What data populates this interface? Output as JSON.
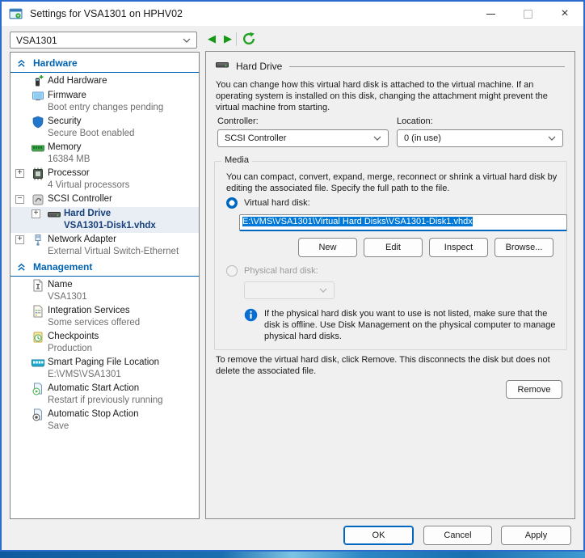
{
  "window": {
    "title": "Settings for VSA1301 on HPHV02"
  },
  "icons": {
    "back": "◀",
    "forward": "▶",
    "close": "×"
  },
  "toolbar": {
    "vm_name": "VSA1301"
  },
  "sidebar": {
    "sections": [
      {
        "header": "Hardware",
        "items": [
          {
            "label": "Add Hardware"
          },
          {
            "label": "Firmware",
            "sub": "Boot entry changes pending"
          },
          {
            "label": "Security",
            "sub": "Secure Boot enabled"
          },
          {
            "label": "Memory",
            "sub": "16384 MB"
          },
          {
            "label": "Processor",
            "sub": "4 Virtual processors",
            "expander": "+"
          },
          {
            "label": "SCSI Controller",
            "expander": "−"
          },
          {
            "label": "Hard Drive",
            "sub": "VSA1301-Disk1.vhdx",
            "expander": "+"
          },
          {
            "label": "Network Adapter",
            "sub": "External Virtual Switch-Ethernet",
            "expander": "+"
          }
        ]
      },
      {
        "header": "Management",
        "items": [
          {
            "label": "Name",
            "sub": "VSA1301"
          },
          {
            "label": "Integration Services",
            "sub": "Some services offered"
          },
          {
            "label": "Checkpoints",
            "sub": "Production"
          },
          {
            "label": "Smart Paging File Location",
            "sub": "E:\\VMS\\VSA1301"
          },
          {
            "label": "Automatic Start Action",
            "sub": "Restart if previously running"
          },
          {
            "label": "Automatic Stop Action",
            "sub": "Save"
          }
        ]
      }
    ]
  },
  "main": {
    "title": "Hard Drive",
    "intro": "You can change how this virtual hard disk is attached to the virtual machine. If an operating system is installed on this disk, changing the attachment might prevent the virtual machine from starting.",
    "controller_label": "Controller:",
    "controller_value": "SCSI Controller",
    "location_label": "Location:",
    "location_value": "0 (in use)",
    "media": {
      "title": "Media",
      "intro": "You can compact, convert, expand, merge, reconnect or shrink a virtual hard disk by editing the associated file. Specify the full path to the file.",
      "virtual_label": "Virtual hard disk:",
      "path": "E:\\VMS\\VSA1301\\Virtual Hard Disks\\VSA1301-Disk1.vhdx",
      "new": "New",
      "edit": "Edit",
      "inspect": "Inspect",
      "browse": "Browse...",
      "physical_label": "Physical hard disk:",
      "info": "If the physical hard disk you want to use is not listed, make sure that the disk is offline. Use Disk Management on the physical computer to manage physical hard disks."
    },
    "remove_note": "To remove the virtual hard disk, click Remove. This disconnects the disk but does not delete the associated file.",
    "remove": "Remove"
  },
  "footer": {
    "ok": "OK",
    "cancel": "Cancel",
    "apply": "Apply"
  },
  "colors": {
    "accent": "#0067c0",
    "header_blue": "#0063b1",
    "selected_tree_text": "#17407b",
    "selection_bg": "#0078d7"
  }
}
